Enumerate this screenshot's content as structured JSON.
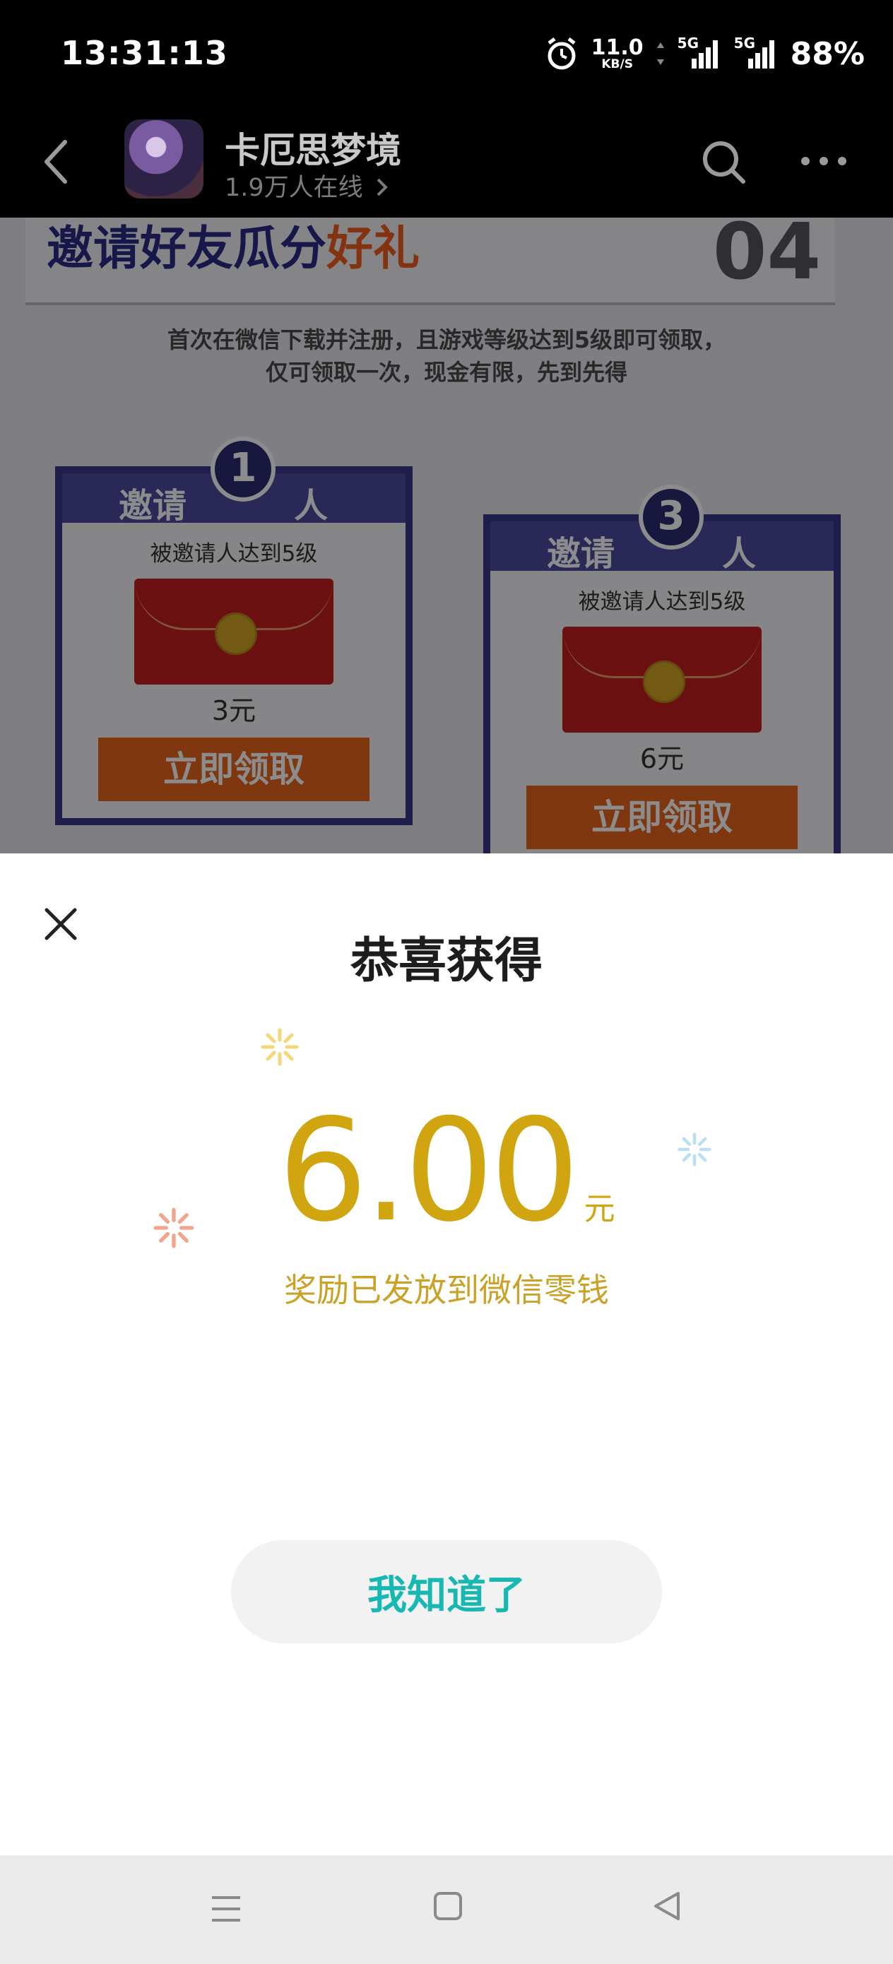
{
  "status_bar": {
    "time": "13:31:13",
    "net_speed_value": "11.0",
    "net_speed_unit": "KB/S",
    "signal_1": "5G",
    "signal_2": "5G",
    "battery": "88%",
    "icons": [
      "alarm-icon",
      "data-arrows-icon",
      "signal-icon",
      "signal-icon"
    ]
  },
  "header": {
    "title": "卡厄思梦境",
    "subtitle": "1.9万人在线",
    "icons": [
      "back-icon",
      "app-icon",
      "chevron-right-icon",
      "search-icon",
      "more-icon"
    ]
  },
  "background_page": {
    "banner_title_prefix": "邀请好友瓜分",
    "banner_title_highlight": "好礼",
    "banner_number": "04",
    "notice_line1": "首次在微信下载并注册，且游戏等级达到5级即可领取，",
    "notice_line2": "仅可领取一次，现金有限，先到先得",
    "cards": [
      {
        "label_left": "邀请",
        "count": "1",
        "label_right": "人",
        "condition": "被邀请人达到5级",
        "amount": "3元",
        "button": "立即领取"
      },
      {
        "label_left": "邀请",
        "count": "3",
        "label_right": "人",
        "condition": "被邀请人达到5级",
        "amount": "6元",
        "button": "立即领取"
      }
    ]
  },
  "sheet": {
    "title": "恭喜获得",
    "amount": "6.00",
    "unit": "元",
    "description": "奖励已发放到微信零钱",
    "confirm_label": "我知道了",
    "colors": {
      "amount": "#d1a510",
      "button_text": "#18b8b2",
      "button_bg": "#f2f2f2"
    }
  },
  "nav_bar": {
    "icons": [
      "menu-icon",
      "home-icon",
      "back-triangle-icon"
    ]
  }
}
